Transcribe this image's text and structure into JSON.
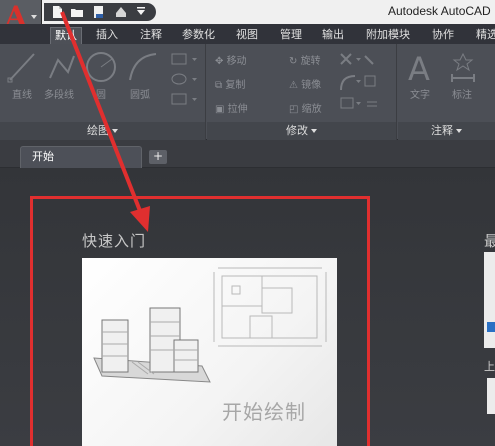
{
  "window": {
    "title": "Autodesk AutoCAD"
  },
  "quick_access": {
    "icons": [
      "new-file-icon",
      "open-folder-icon",
      "save-icon",
      "print-icon",
      "dropdown-caret-icon"
    ]
  },
  "ribbon_tabs": [
    "默认",
    "插入",
    "注释",
    "参数化",
    "视图",
    "管理",
    "输出",
    "附加模块",
    "协作",
    "精选"
  ],
  "ribbon": {
    "draw": {
      "title": "绘图",
      "tools": {
        "line": "直线",
        "polyline": "多段线",
        "circle": "圆",
        "arc": "圆弧"
      }
    },
    "modify": {
      "title": "修改",
      "tools": {
        "move": "移动",
        "rotate": "旋转",
        "copy": "复制",
        "mirror": "镜像",
        "stretch": "拉伸",
        "scale": "缩放"
      }
    },
    "annotation": {
      "title": "注释",
      "tools": {
        "text": "文字",
        "dimension": "标注"
      }
    }
  },
  "document_tabs": {
    "active": "开始",
    "new_tab": "+"
  },
  "start_page": {
    "quick_start_heading": "快速入门",
    "recent_heading": "最",
    "card_caption": "开始绘制",
    "side_label": "上"
  },
  "colors": {
    "highlight": "#e02f2f",
    "app_red": "#d8312c",
    "ribbon_bg": "#4c4f56"
  }
}
